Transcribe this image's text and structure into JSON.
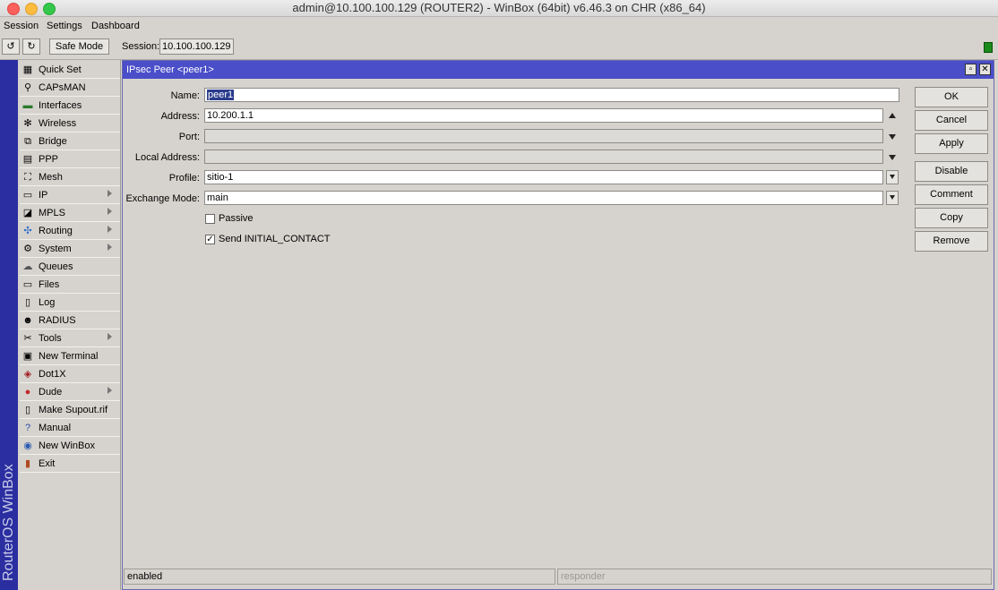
{
  "window": {
    "title": "admin@10.100.100.129 (ROUTER2) - WinBox (64bit) v6.46.3 on CHR (x86_64)"
  },
  "menu": [
    "Session",
    "Settings",
    "Dashboard"
  ],
  "toolbar": {
    "safe_mode": "Safe Mode",
    "session_label": "Session:",
    "session_value": "10.100.100.129"
  },
  "brand": "RouterOS WinBox",
  "sidebar": {
    "items": [
      {
        "label": "Quick Set",
        "icon": "quick-set-icon",
        "submenu": false
      },
      {
        "label": "CAPsMAN",
        "icon": "capsman-icon",
        "submenu": false
      },
      {
        "label": "Interfaces",
        "icon": "interfaces-icon",
        "submenu": false
      },
      {
        "label": "Wireless",
        "icon": "wireless-icon",
        "submenu": false
      },
      {
        "label": "Bridge",
        "icon": "bridge-icon",
        "submenu": false
      },
      {
        "label": "PPP",
        "icon": "ppp-icon",
        "submenu": false
      },
      {
        "label": "Mesh",
        "icon": "mesh-icon",
        "submenu": false
      },
      {
        "label": "IP",
        "icon": "ip-icon",
        "submenu": true
      },
      {
        "label": "MPLS",
        "icon": "mpls-icon",
        "submenu": true
      },
      {
        "label": "Routing",
        "icon": "routing-icon",
        "submenu": true
      },
      {
        "label": "System",
        "icon": "system-icon",
        "submenu": true
      },
      {
        "label": "Queues",
        "icon": "queues-icon",
        "submenu": false
      },
      {
        "label": "Files",
        "icon": "files-icon",
        "submenu": false
      },
      {
        "label": "Log",
        "icon": "log-icon",
        "submenu": false
      },
      {
        "label": "RADIUS",
        "icon": "radius-icon",
        "submenu": false
      },
      {
        "label": "Tools",
        "icon": "tools-icon",
        "submenu": true
      },
      {
        "label": "New Terminal",
        "icon": "terminal-icon",
        "submenu": false
      },
      {
        "label": "Dot1X",
        "icon": "dot1x-icon",
        "submenu": false
      },
      {
        "label": "Dude",
        "icon": "dude-icon",
        "submenu": true
      },
      {
        "label": "Make Supout.rif",
        "icon": "supout-icon",
        "submenu": false
      },
      {
        "label": "Manual",
        "icon": "manual-icon",
        "submenu": false
      },
      {
        "label": "New WinBox",
        "icon": "winbox-icon",
        "submenu": false
      },
      {
        "label": "Exit",
        "icon": "exit-icon",
        "submenu": false
      }
    ]
  },
  "dialog": {
    "title": "IPsec Peer <peer1>",
    "fields": {
      "name": {
        "label": "Name:",
        "value": "peer1"
      },
      "address": {
        "label": "Address:",
        "value": "10.200.1.1"
      },
      "port": {
        "label": "Port:",
        "value": ""
      },
      "local_address": {
        "label": "Local Address:",
        "value": ""
      },
      "profile": {
        "label": "Profile:",
        "value": "sitio-1"
      },
      "exchange_mode": {
        "label": "Exchange Mode:",
        "value": "main"
      }
    },
    "passive": {
      "label": "Passive",
      "checked": false
    },
    "send_initial_contact": {
      "label": "Send INITIAL_CONTACT",
      "checked": true
    },
    "buttons": {
      "ok": "OK",
      "cancel": "Cancel",
      "apply": "Apply",
      "disable": "Disable",
      "comment": "Comment",
      "copy": "Copy",
      "remove": "Remove"
    },
    "status": {
      "left": "enabled",
      "right": "responder"
    }
  },
  "colors": {
    "titlebar_blue": "#4a4ec8",
    "brand_bar": "#2a2ea0",
    "status_led": "#1a8a1a"
  }
}
